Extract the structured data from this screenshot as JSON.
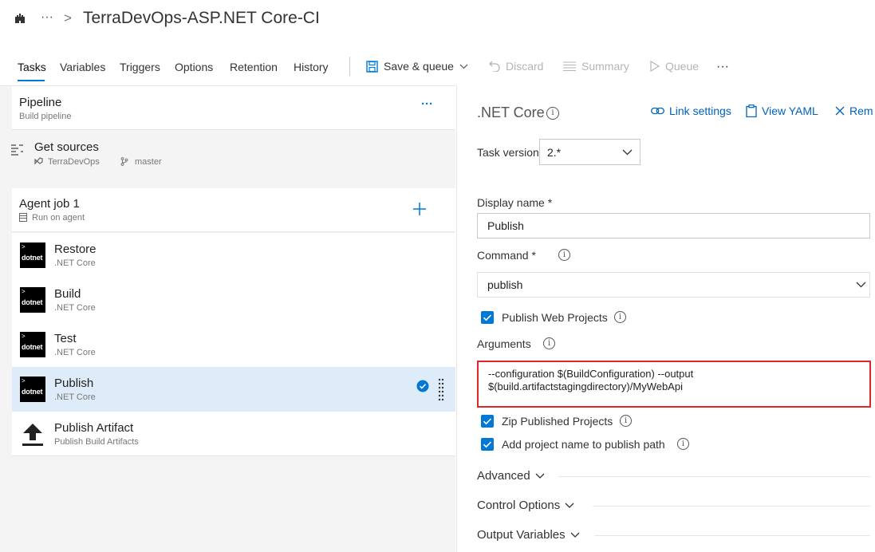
{
  "header": {
    "title": "TerraDevOps-ASP.NET Core-CI",
    "ellipsis": "···",
    "chevron": ">"
  },
  "tabs": [
    {
      "label": "Tasks"
    },
    {
      "label": "Variables"
    },
    {
      "label": "Triggers"
    },
    {
      "label": "Options"
    },
    {
      "label": "Retention"
    },
    {
      "label": "History"
    }
  ],
  "toolbar": {
    "save_queue": "Save & queue",
    "discard": "Discard",
    "summary": "Summary",
    "queue": "Queue",
    "more": "···"
  },
  "pipeline": {
    "title": "Pipeline",
    "subtitle": "Build pipeline",
    "more": "···"
  },
  "get_sources": {
    "title": "Get sources",
    "repo": "TerraDevOps",
    "branch": "master"
  },
  "agent_job": {
    "title": "Agent job 1",
    "subtitle": "Run on agent"
  },
  "tasks": [
    {
      "name": "Restore",
      "type": ".NET Core",
      "icon": "dotnet"
    },
    {
      "name": "Build",
      "type": ".NET Core",
      "icon": "dotnet"
    },
    {
      "name": "Test",
      "type": ".NET Core",
      "icon": "dotnet"
    },
    {
      "name": "Publish",
      "type": ".NET Core",
      "icon": "dotnet",
      "selected": true
    },
    {
      "name": "Publish Artifact",
      "type": "Publish Build Artifacts",
      "icon": "upload-arrow"
    }
  ],
  "dotnet_icon_label": "dotnet",
  "details": {
    "title": ".NET Core",
    "link_settings": "Link settings",
    "view_yaml": "View YAML",
    "remove": "Rem",
    "task_version_label": "Task version",
    "task_version_value": "2.*",
    "display_name_label": "Display name *",
    "display_name_value": "Publish",
    "command_label": "Command *",
    "command_value": "publish",
    "publish_web_projects": "Publish Web Projects",
    "arguments_label": "Arguments",
    "arguments_line1": "--configuration $(BuildConfiguration) --output",
    "arguments_line2": "$(build.artifactstagingdirectory)/MyWebApi",
    "zip_published": "Zip Published Projects",
    "add_project_name": "Add project name to publish path",
    "sections": [
      "Advanced",
      "Control Options",
      "Output Variables"
    ]
  },
  "colors": {
    "accent": "#0078d4",
    "highlight_border": "#e0252b",
    "selected_row": "#deecf9"
  }
}
